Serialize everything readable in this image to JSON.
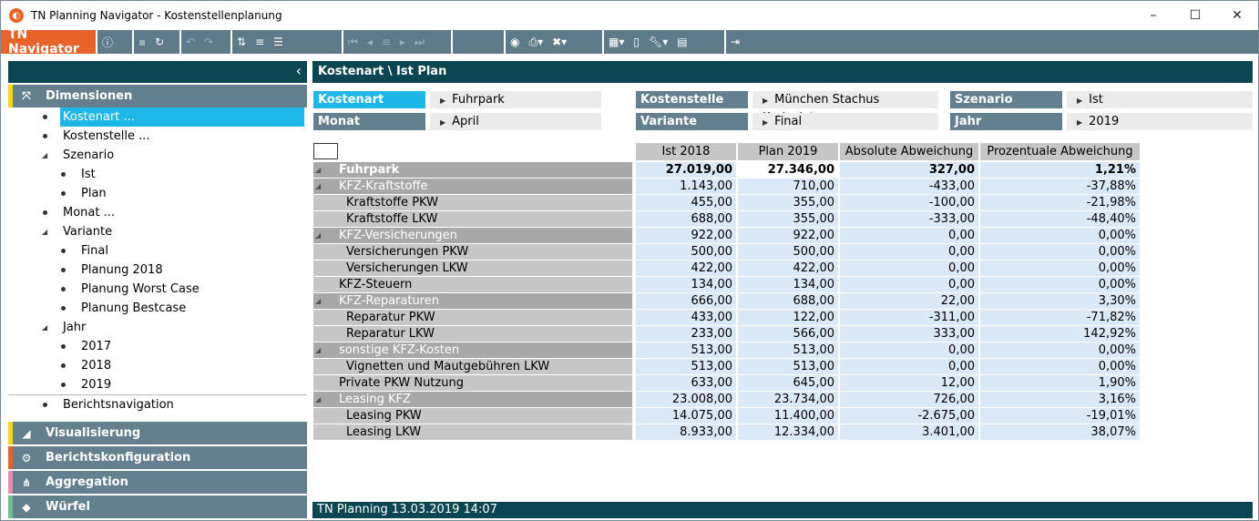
{
  "window": {
    "title": "TN Planning Navigator - Kostenstellenplanung",
    "controls": {
      "minimize": "–",
      "maximize": "☐",
      "close": "✕"
    }
  },
  "toolbar": {
    "brand": "TN Navigator"
  },
  "sidebar": {
    "collapse_glyph": "‹",
    "sections": [
      {
        "label": "Dimensionen",
        "color": "#f5d61a",
        "icon": "dimensions-icon"
      },
      {
        "label": "Visualisierung",
        "color": "#f5d61a",
        "icon": "chart-icon"
      },
      {
        "label": "Berichtskonfiguration",
        "color": "#e8632a",
        "icon": "config-icon"
      },
      {
        "label": "Aggregation",
        "color": "#e08fb0",
        "icon": "aggregation-icon"
      },
      {
        "label": "Würfel",
        "color": "#6fbf8f",
        "icon": "cube-icon"
      }
    ],
    "tree": [
      {
        "label": "Kostenart ...",
        "level": 1,
        "kind": "bullet",
        "selected": true
      },
      {
        "label": "Kostenstelle ...",
        "level": 1,
        "kind": "bullet"
      },
      {
        "label": "Szenario",
        "level": 1,
        "kind": "expand"
      },
      {
        "label": "Ist",
        "level": 2,
        "kind": "bullet"
      },
      {
        "label": "Plan",
        "level": 2,
        "kind": "bullet"
      },
      {
        "label": "Monat ...",
        "level": 1,
        "kind": "bullet"
      },
      {
        "label": "Variante",
        "level": 1,
        "kind": "expand"
      },
      {
        "label": "Final",
        "level": 2,
        "kind": "bullet"
      },
      {
        "label": "Planung 2018",
        "level": 2,
        "kind": "bullet"
      },
      {
        "label": "Planung Worst Case",
        "level": 2,
        "kind": "bullet"
      },
      {
        "label": "Planung Bestcase",
        "level": 2,
        "kind": "bullet"
      },
      {
        "label": "Jahr",
        "level": 1,
        "kind": "expand"
      },
      {
        "label": "2017",
        "level": 2,
        "kind": "bullet"
      },
      {
        "label": "2018",
        "level": 2,
        "kind": "bullet"
      },
      {
        "label": "2019",
        "level": 2,
        "kind": "bullet"
      },
      {
        "label": "Berichtsnavigation",
        "level": 1,
        "kind": "bullet",
        "separator": true
      }
    ]
  },
  "main": {
    "title": "Kostenart \\ Ist Plan",
    "filters": [
      {
        "label": "Kostenart",
        "value": "Fuhrpark",
        "active": true
      },
      {
        "label": "Kostenstelle",
        "value": "München Stachus Karlsplatz"
      },
      {
        "label": "Szenario",
        "value": "Ist"
      },
      {
        "label": "Monat",
        "value": "April"
      },
      {
        "label": "Variante",
        "value": "Final"
      },
      {
        "label": "Jahr",
        "value": "2019"
      }
    ],
    "columns": [
      "Ist 2018",
      "Plan 2019",
      "Absolute Abweichung",
      "Prozentuale Abweichung"
    ],
    "rows": [
      {
        "label": "Fuhrpark",
        "level": 0,
        "values": [
          "27.019,00",
          "27.346,00",
          "327,00",
          "1,21%"
        ]
      },
      {
        "label": "KFZ-Kraftstoffe",
        "level": 1,
        "values": [
          "1.143,00",
          "710,00",
          "-433,00",
          "-37,88%"
        ]
      },
      {
        "label": "Kraftstoffe PKW",
        "level": 2,
        "values": [
          "455,00",
          "355,00",
          "-100,00",
          "-21,98%"
        ]
      },
      {
        "label": "Kraftstoffe LKW",
        "level": 2,
        "values": [
          "688,00",
          "355,00",
          "-333,00",
          "-48,40%"
        ]
      },
      {
        "label": "KFZ-Versicherungen",
        "level": 1,
        "values": [
          "922,00",
          "922,00",
          "0,00",
          "0,00%"
        ]
      },
      {
        "label": "Versicherungen PKW",
        "level": 2,
        "values": [
          "500,00",
          "500,00",
          "0,00",
          "0,00%"
        ]
      },
      {
        "label": "Versicherungen LKW",
        "level": 2,
        "values": [
          "422,00",
          "422,00",
          "0,00",
          "0,00%"
        ]
      },
      {
        "label": "KFZ-Steuern",
        "level": 1,
        "leaf": true,
        "values": [
          "134,00",
          "134,00",
          "0,00",
          "0,00%"
        ]
      },
      {
        "label": "KFZ-Reparaturen",
        "level": 1,
        "values": [
          "666,00",
          "688,00",
          "22,00",
          "3,30%"
        ]
      },
      {
        "label": "Reparatur PKW",
        "level": 2,
        "values": [
          "433,00",
          "122,00",
          "-311,00",
          "-71,82%"
        ]
      },
      {
        "label": "Reparatur LKW",
        "level": 2,
        "values": [
          "233,00",
          "566,00",
          "333,00",
          "142,92%"
        ]
      },
      {
        "label": "sonstige KFZ-Kosten",
        "level": 1,
        "values": [
          "513,00",
          "513,00",
          "0,00",
          "0,00%"
        ]
      },
      {
        "label": "Vignetten und Mautgebühren LKW",
        "level": 2,
        "values": [
          "513,00",
          "513,00",
          "0,00",
          "0,00%"
        ]
      },
      {
        "label": "Private PKW Nutzung",
        "level": 1,
        "leaf": true,
        "values": [
          "633,00",
          "645,00",
          "12,00",
          "1,90%"
        ]
      },
      {
        "label": "Leasing KFZ",
        "level": 1,
        "values": [
          "23.008,00",
          "23.734,00",
          "726,00",
          "3,16%"
        ]
      },
      {
        "label": "Leasing PKW",
        "level": 2,
        "values": [
          "14.075,00",
          "11.400,00",
          "-2.675,00",
          "-19,01%"
        ]
      },
      {
        "label": "Leasing LKW",
        "level": 2,
        "values": [
          "8.933,00",
          "12.334,00",
          "3.401,00",
          "38,07%"
        ]
      }
    ]
  },
  "status": {
    "text": "TN Planning 13.03.2019 14:07"
  },
  "colors": {
    "accent": "#e8632a",
    "header": "#0b4652",
    "selection": "#1fb6e8",
    "panel": "#64808f"
  }
}
